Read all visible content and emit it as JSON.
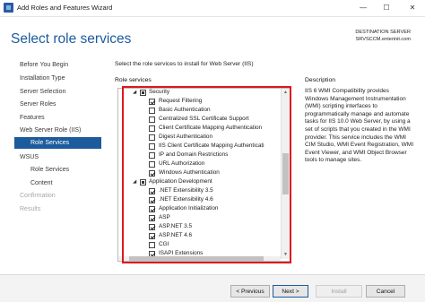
{
  "window": {
    "title": "Add Roles and Features Wizard",
    "min": "—",
    "max": "☐",
    "close": "✕"
  },
  "header": {
    "page_title": "Select role services",
    "dest_label": "DESTINATION SERVER",
    "dest_server": "SRVSCCM.enterinit.com"
  },
  "sidebar": {
    "items": [
      {
        "label": "Before You Begin"
      },
      {
        "label": "Installation Type"
      },
      {
        "label": "Server Selection"
      },
      {
        "label": "Server Roles"
      },
      {
        "label": "Features"
      },
      {
        "label": "Web Server Role (IIS)"
      },
      {
        "label": "Role Services"
      },
      {
        "label": "WSUS"
      },
      {
        "label": "Role Services"
      },
      {
        "label": "Content"
      },
      {
        "label": "Confirmation"
      },
      {
        "label": "Results"
      }
    ]
  },
  "main": {
    "intro": "Select the role services to install for Web Server (IIS)",
    "role_services_header": "Role services",
    "description_header": "Description",
    "description": "IIS 6 WMI Compatibility provides Windows Management Instrumentation (WMI) scripting interfaces to programmatically manage and automate tasks for IIS 10.0 Web Server, by using a set of scripts that you created in the WMI provider. This service includes the WMI CIM Studio, WMI Event Registration, WMI Event Viewer, and WMI Object Browser tools to manage sites.",
    "tree": [
      {
        "label": "Security",
        "state": "partial",
        "expand": "◢"
      },
      {
        "label": "Request Filtering",
        "state": "checked"
      },
      {
        "label": "Basic Authentication",
        "state": "unchecked"
      },
      {
        "label": "Centralized SSL Certificate Support",
        "state": "unchecked"
      },
      {
        "label": "Client Certificate Mapping Authentication",
        "state": "unchecked"
      },
      {
        "label": "Digest Authentication",
        "state": "unchecked"
      },
      {
        "label": "IIS Client Certificate Mapping Authenticati",
        "state": "unchecked"
      },
      {
        "label": "IP and Domain Restrictions",
        "state": "unchecked"
      },
      {
        "label": "URL Authorization",
        "state": "unchecked"
      },
      {
        "label": "Windows Authentication",
        "state": "checked"
      },
      {
        "label": "Application Development",
        "state": "partial",
        "expand": "◢"
      },
      {
        "label": ".NET Extensibility 3.5",
        "state": "checked"
      },
      {
        "label": ".NET Extensibility 4.6",
        "state": "checked"
      },
      {
        "label": "Application Initialization",
        "state": "checked"
      },
      {
        "label": "ASP",
        "state": "checked"
      },
      {
        "label": "ASP.NET 3.5",
        "state": "checked"
      },
      {
        "label": "ASP.NET 4.6",
        "state": "checked"
      },
      {
        "label": "CGI",
        "state": "unchecked"
      },
      {
        "label": "ISAPI Extensions",
        "state": "checked"
      }
    ]
  },
  "footer": {
    "previous": "< Previous",
    "next": "Next >",
    "install": "Install",
    "cancel": "Cancel"
  },
  "colors": {
    "accent": "#1c5b9c",
    "highlight": "#e0161e"
  }
}
